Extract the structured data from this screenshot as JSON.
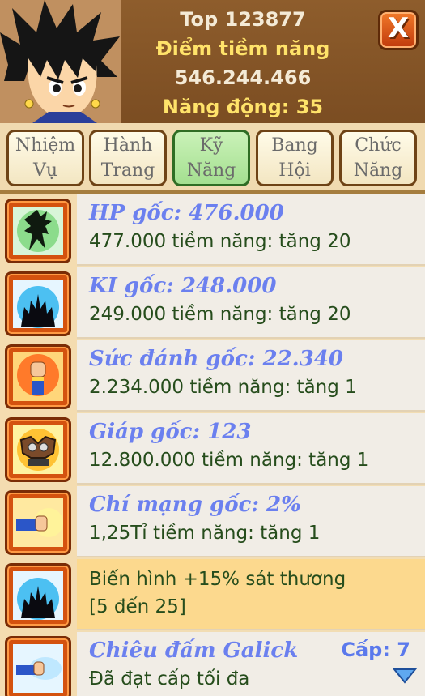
{
  "header": {
    "rank": "Top 123877",
    "potential_label": "Điểm tiềm năng",
    "potential_value": "546.244.466",
    "activity": "Năng động: 35",
    "close_label": "X"
  },
  "tabs": [
    {
      "line1": "Nhiệm",
      "line2": "Vụ"
    },
    {
      "line1": "Hành",
      "line2": "Trang"
    },
    {
      "line1": "Kỹ",
      "line2": "Năng",
      "active": true
    },
    {
      "line1": "Bang",
      "line2": "Hội"
    },
    {
      "line1": "Chức",
      "line2": "Năng"
    }
  ],
  "stats": [
    {
      "title": "HP gốc: 476.000",
      "sub": "477.000 tiềm năng: tăng 20",
      "icon": "green-silhouette-icon"
    },
    {
      "title": "KI gốc: 248.000",
      "sub": "249.000 tiềm năng: tăng 20",
      "icon": "blue-aura-icon"
    },
    {
      "title": "Sức đánh gốc: 22.340",
      "sub": "2.234.000 tiềm năng: tăng 1",
      "icon": "fist-icon"
    },
    {
      "title": "Giáp gốc: 123",
      "sub": "12.800.000 tiềm năng: tăng 1",
      "icon": "armor-icon"
    },
    {
      "title": "Chí mạng gốc: 2%",
      "sub": "1,25Tỉ tiềm năng: tăng 1",
      "icon": "punch-blast-icon"
    },
    {
      "desc1": "Biến hình +15% sát thương",
      "desc2": "[5 đến 25]",
      "icon": "transform-icon"
    },
    {
      "title": "Chiêu đấm Galick",
      "sub": "Đã đạt cấp tối đa",
      "level": "Cấp: 7",
      "icon": "galick-icon"
    }
  ],
  "colors": {
    "header_bg": "#8e5d2c",
    "gold_text": "#ffe36a",
    "title_blue": "#6b80ef",
    "sub_green": "#264d1c",
    "highlight_bg": "#fcd98e",
    "close_orange": "#e0561a"
  }
}
